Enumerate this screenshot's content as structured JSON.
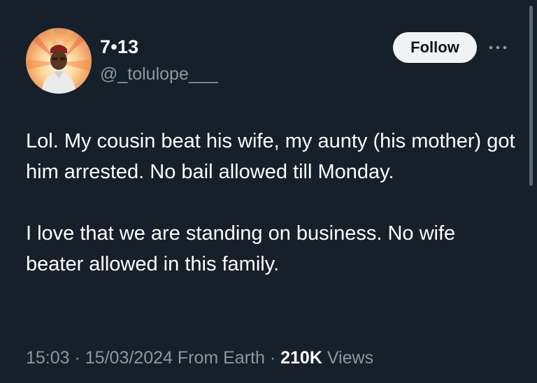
{
  "author": {
    "display_name": "7•13",
    "handle": "@_tolulope___",
    "avatar_icon": "profile-photo"
  },
  "actions": {
    "follow_label": "Follow",
    "more_icon": "more-horizontal-icon"
  },
  "tweet": {
    "paragraphs": [
      "Lol. My cousin beat his wife, my aunty (his mother) got him arrested. No bail allowed till Monday.",
      "I love that we are standing on business. No wife beater allowed in this family."
    ]
  },
  "meta": {
    "time": "15:03",
    "separator": " · ",
    "date": "15/03/2024",
    "source": "From Earth",
    "views_count": "210K",
    "views_label": "Views"
  },
  "colors": {
    "background": "#15202b",
    "text_primary": "#ffffff",
    "text_secondary": "#8b98a5",
    "follow_button_bg": "#eff3f4",
    "follow_button_text": "#0f1419"
  }
}
